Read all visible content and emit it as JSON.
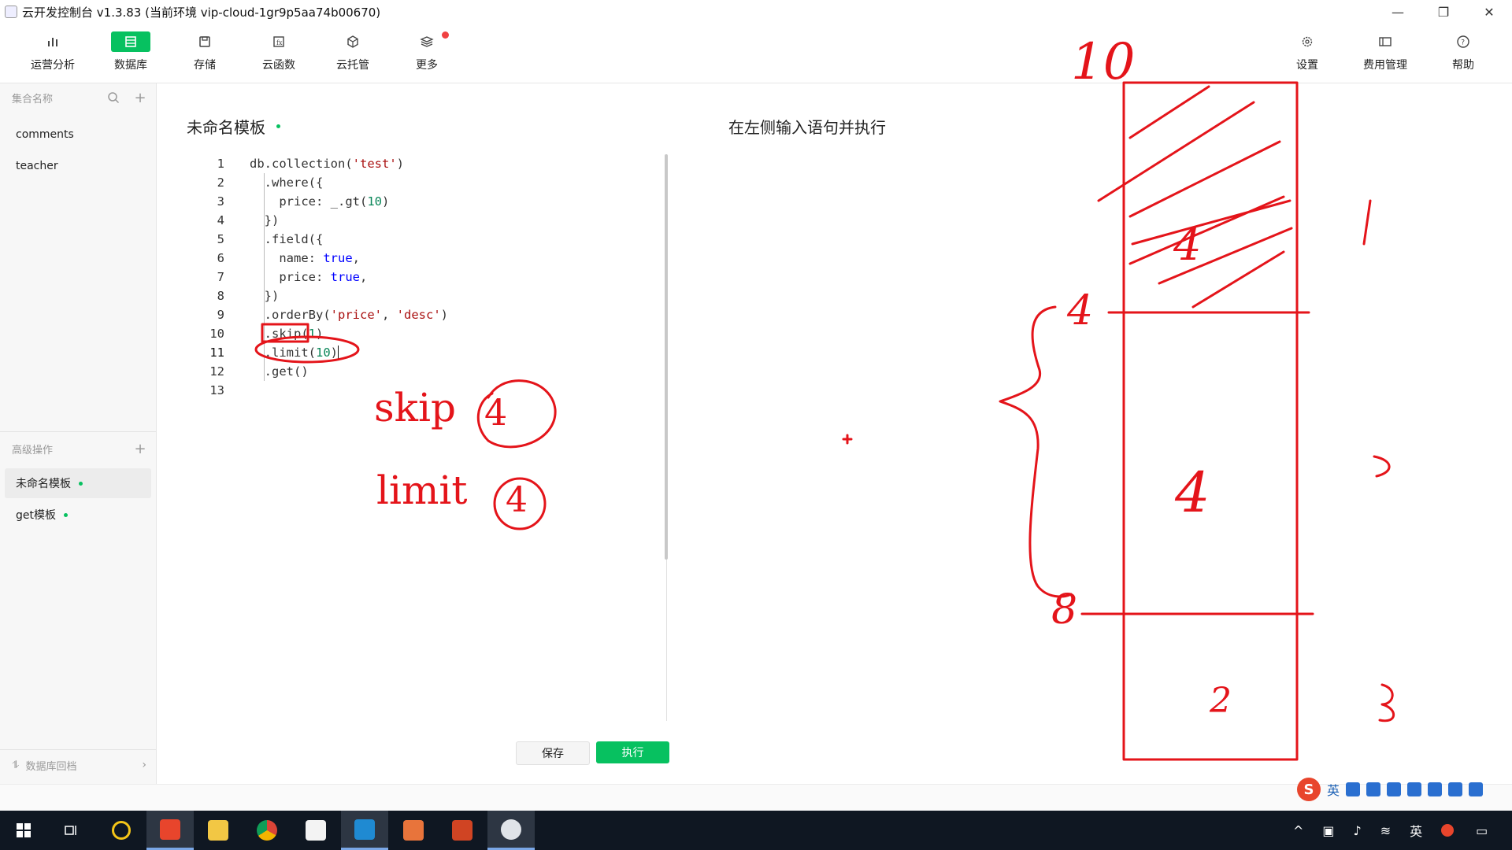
{
  "window": {
    "title": "云开发控制台 v1.3.83  (当前环境 vip-cloud-1gr9p5aa74b00670)",
    "controls": [
      "—",
      "❐",
      "✕"
    ]
  },
  "toolbar": {
    "left": [
      {
        "label": "运营分析",
        "icon": "bar-chart-icon"
      },
      {
        "label": "数据库",
        "icon": "database-icon",
        "active": true
      },
      {
        "label": "存储",
        "icon": "storage-icon"
      },
      {
        "label": "云函数",
        "icon": "function-icon"
      },
      {
        "label": "云托管",
        "icon": "cube-icon"
      },
      {
        "label": "更多",
        "icon": "layers-icon",
        "badge": true
      }
    ],
    "right": [
      {
        "label": "设置",
        "icon": "gear-icon"
      },
      {
        "label": "费用管理",
        "icon": "billing-icon"
      },
      {
        "label": "帮助",
        "icon": "help-icon"
      }
    ]
  },
  "sidebar": {
    "collections_header": "集合名称",
    "collections": [
      "comments",
      "teacher"
    ],
    "advanced_header": "高级操作",
    "templates": [
      {
        "label": "未命名模板",
        "active": true
      },
      {
        "label": "get模板",
        "active": false
      }
    ],
    "footer": "数据库回档"
  },
  "editor": {
    "title": "未命名模板",
    "lines": [
      "db.collection('test')",
      "  .where({",
      "    price: _.gt(10)",
      "  })",
      "  .field({",
      "    name: true,",
      "    price: true,",
      "  })",
      "  .orderBy('price', 'desc')",
      "  .skip(1)",
      "  .limit(10)",
      "  .get()",
      ""
    ],
    "line_numbers": [
      "1",
      "2",
      "3",
      "4",
      "5",
      "6",
      "7",
      "8",
      "9",
      "10",
      "11",
      "12",
      "13"
    ],
    "current_line": 11,
    "save_label": "保存",
    "run_label": "执行"
  },
  "result": {
    "placeholder": "在左侧输入语句并执行"
  },
  "annotations": {
    "skip_text": "skip",
    "skip_circled": "4",
    "limit_text": "limit",
    "limit_circled": "4",
    "num_top": "10",
    "num_left_top": "0",
    "num_four_mark": "4",
    "num_eight_mark": "8",
    "num_box_top": "4",
    "num_box_mid": "4",
    "num_box_bottom": "2",
    "num_right_1": "1",
    "num_right_2": "2",
    "num_right_3": "3"
  },
  "ime": {
    "logo": "S",
    "mode": "英"
  },
  "taskbar": {
    "tray_lang": "英"
  }
}
